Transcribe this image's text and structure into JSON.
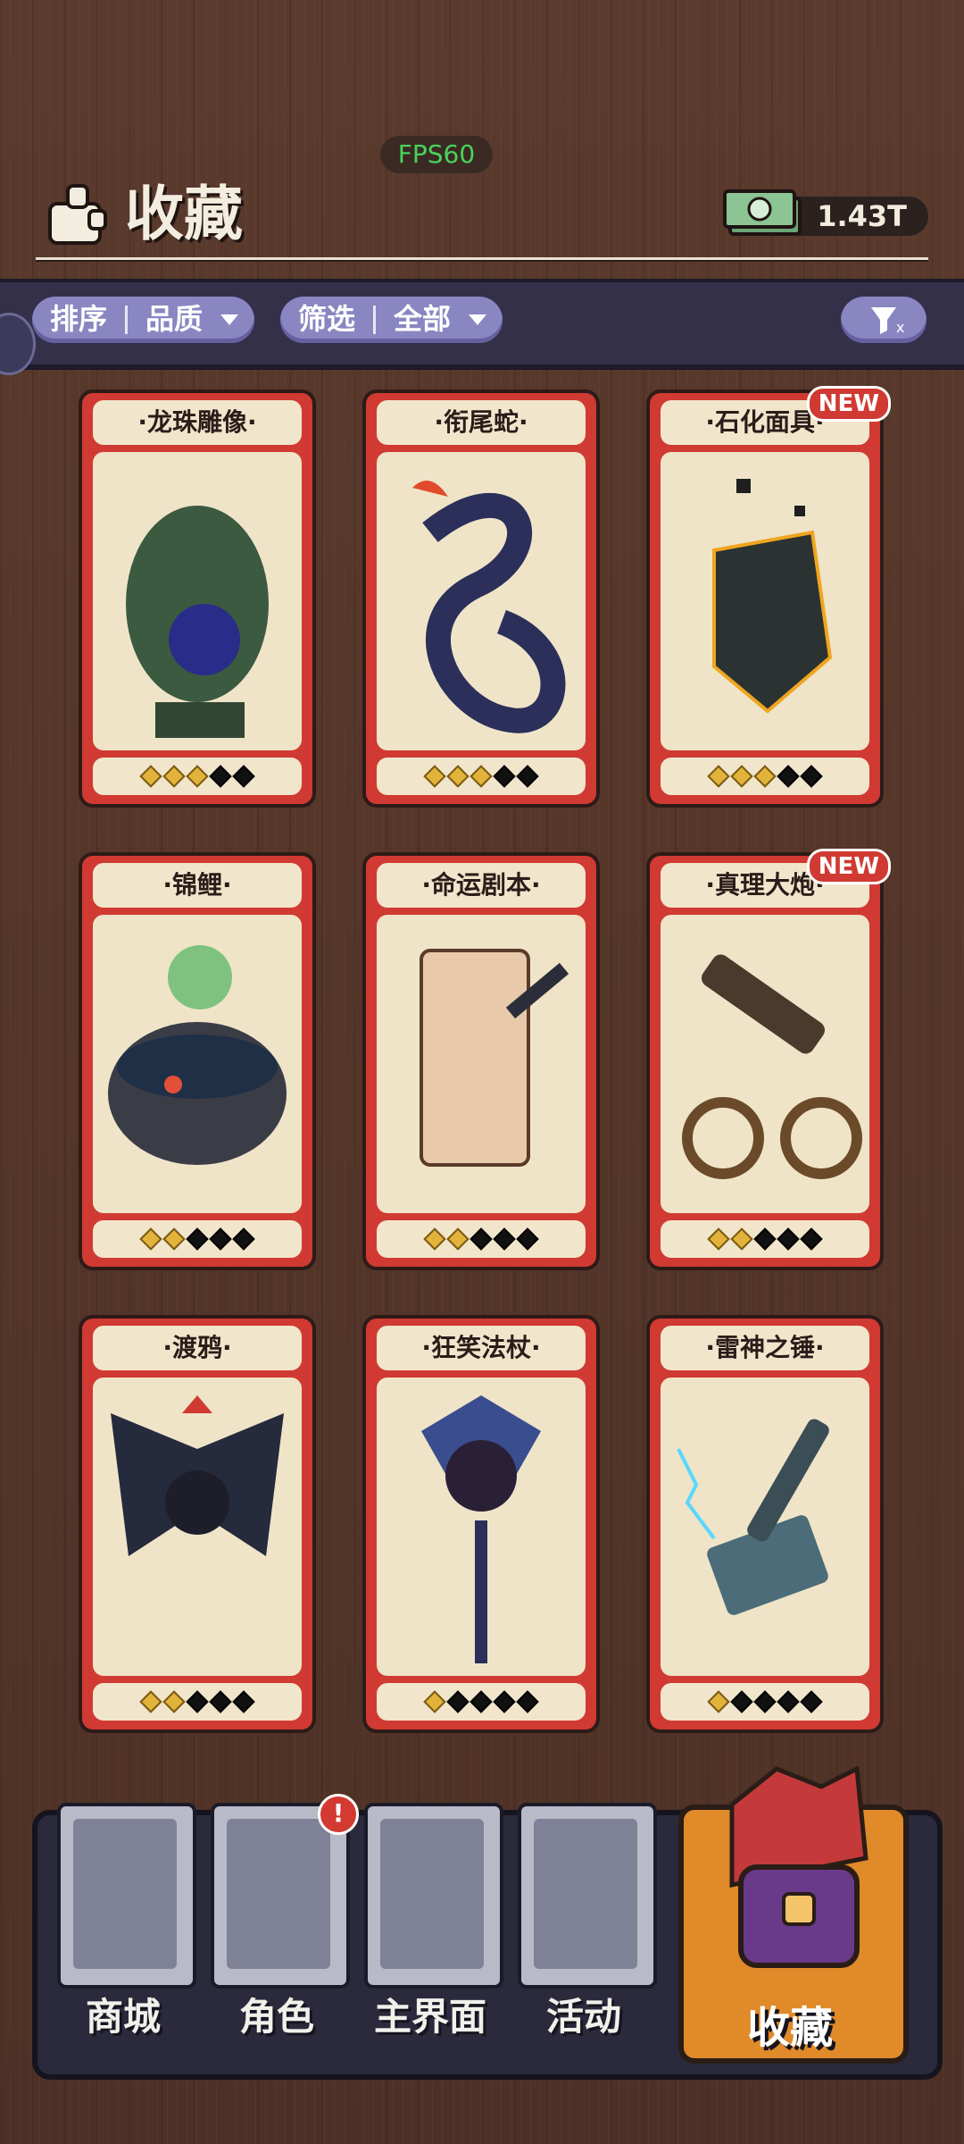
{
  "overlay": {
    "fps": "FPS60"
  },
  "header": {
    "title": "收藏",
    "currency_value": "1.43T"
  },
  "filters": {
    "sort_label": "排序",
    "sort_value": "品质",
    "filter_label": "筛选",
    "filter_value": "全部"
  },
  "colors": {
    "card_red": "#d03a32",
    "card_cream": "#efe4c8",
    "pill_purple": "#8a86c2",
    "fps_green": "#49d25a",
    "active_tab_orange": "#e08a2a"
  },
  "cards": [
    {
      "name": "·龙珠雕像·",
      "stars_on": 3,
      "stars_total": 5,
      "is_new": false
    },
    {
      "name": "·衔尾蛇·",
      "stars_on": 3,
      "stars_total": 5,
      "is_new": false
    },
    {
      "name": "·石化面具·",
      "stars_on": 3,
      "stars_total": 5,
      "is_new": true,
      "new_label": "NEW"
    },
    {
      "name": "·锦鲤·",
      "stars_on": 2,
      "stars_total": 5,
      "is_new": false
    },
    {
      "name": "·命运剧本·",
      "stars_on": 2,
      "stars_total": 5,
      "is_new": false
    },
    {
      "name": "·真理大炮·",
      "stars_on": 2,
      "stars_total": 5,
      "is_new": true,
      "new_label": "NEW"
    },
    {
      "name": "·渡鸦·",
      "stars_on": 2,
      "stars_total": 5,
      "is_new": false
    },
    {
      "name": "·狂笑法杖·",
      "stars_on": 1,
      "stars_total": 5,
      "is_new": false
    },
    {
      "name": "·雷神之锤·",
      "stars_on": 1,
      "stars_total": 5,
      "is_new": false
    }
  ],
  "tabs": [
    {
      "label": "商城",
      "icon": "shop-icon"
    },
    {
      "label": "角色",
      "icon": "character-icon",
      "badge": "!"
    },
    {
      "label": "主界面",
      "icon": "home-icon"
    },
    {
      "label": "活动",
      "icon": "event-icon"
    },
    {
      "label": "收藏",
      "icon": "collection-icon",
      "active": true
    }
  ]
}
